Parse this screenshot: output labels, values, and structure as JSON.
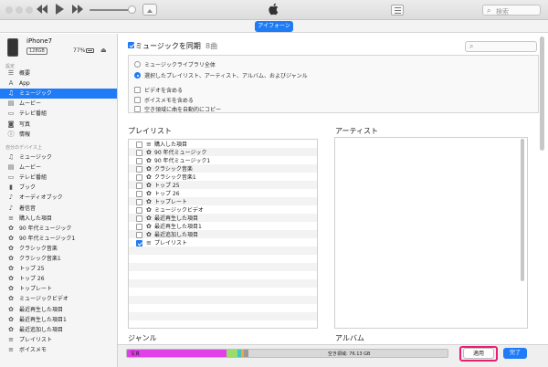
{
  "toolbar": {
    "prev_icon": "rewind-icon",
    "play_icon": "play-icon",
    "next_icon": "fast-forward-icon",
    "search_placeholder": "検索"
  },
  "device_band": {
    "device_tab_label": "アイフォーン"
  },
  "device": {
    "name": "iPhone7",
    "capacity": "128GB",
    "battery": "77%"
  },
  "sidebar": {
    "settings_header": "設定",
    "settings_items": [
      {
        "label": "概要",
        "icon": "summary-icon"
      },
      {
        "label": "App",
        "icon": "app-icon"
      },
      {
        "label": "ミュージック",
        "icon": "music-note-icon",
        "selected": true
      },
      {
        "label": "ムービー",
        "icon": "film-icon"
      },
      {
        "label": "テレビ番組",
        "icon": "tv-icon"
      },
      {
        "label": "写真",
        "icon": "camera-icon"
      },
      {
        "label": "情報",
        "icon": "info-icon"
      }
    ],
    "ondevice_header": "自分のデバイス上",
    "ondevice_items": [
      {
        "label": "ミュージック",
        "icon": "music-note-icon"
      },
      {
        "label": "ムービー",
        "icon": "film-icon"
      },
      {
        "label": "テレビ番組",
        "icon": "tv-icon"
      },
      {
        "label": "ブック",
        "icon": "book-icon"
      },
      {
        "label": "オーディオブック",
        "icon": "audiobook-icon"
      },
      {
        "label": "着信音",
        "icon": "bell-icon"
      },
      {
        "label": "購入した項目",
        "icon": "playlist-icon"
      },
      {
        "label": "90 年代ミュージック",
        "icon": "smart-playlist-icon"
      },
      {
        "label": "90 年代ミュージック1",
        "icon": "smart-playlist-icon"
      },
      {
        "label": "クラシック音楽",
        "icon": "smart-playlist-icon"
      },
      {
        "label": "クラシック音楽1",
        "icon": "smart-playlist-icon"
      },
      {
        "label": "トップ 25",
        "icon": "smart-playlist-icon"
      },
      {
        "label": "トップ 26",
        "icon": "smart-playlist-icon"
      },
      {
        "label": "トップレート",
        "icon": "smart-playlist-icon"
      },
      {
        "label": "ミュージックビデオ",
        "icon": "smart-playlist-icon"
      },
      {
        "label": "最近再生した項目",
        "icon": "smart-playlist-icon"
      },
      {
        "label": "最近再生した項目1",
        "icon": "smart-playlist-icon"
      },
      {
        "label": "最近追加した項目",
        "icon": "smart-playlist-icon"
      },
      {
        "label": "プレイリスト",
        "icon": "playlist-icon"
      },
      {
        "label": "ボイスメモ",
        "icon": "playlist-icon"
      }
    ]
  },
  "main": {
    "sync_label": "ミュージックを同期",
    "sync_count": "8曲",
    "sync_checked": true,
    "search_icon": "search-icon",
    "options": [
      {
        "type": "radio",
        "label": "ミュージックライブラリ全体",
        "checked": false
      },
      {
        "type": "radio",
        "label": "選択したプレイリスト、アーティスト、アルバム、およびジャンル",
        "checked": true
      },
      {
        "type": "checkbox",
        "label": "ビデオを含める",
        "checked": false
      },
      {
        "type": "checkbox",
        "label": "ボイスメモを含める",
        "checked": false
      },
      {
        "type": "checkbox",
        "label": "空き領域に曲を自動的にコピー",
        "checked": false
      }
    ],
    "playlists_title": "プレイリスト",
    "artists_title": "アーティスト",
    "genres_title": "ジャンル",
    "albums_title": "アルバム",
    "playlists": [
      {
        "label": "購入した項目",
        "icon": "playlist-icon",
        "checked": false
      },
      {
        "label": "90 年代ミュージック",
        "icon": "smart-playlist-icon",
        "checked": false
      },
      {
        "label": "90 年代ミュージック1",
        "icon": "smart-playlist-icon",
        "checked": false
      },
      {
        "label": "クラシック音楽",
        "icon": "smart-playlist-icon",
        "checked": false
      },
      {
        "label": "クラシック音楽1",
        "icon": "smart-playlist-icon",
        "checked": false
      },
      {
        "label": "トップ 25",
        "icon": "smart-playlist-icon",
        "checked": false
      },
      {
        "label": "トップ 26",
        "icon": "smart-playlist-icon",
        "checked": false
      },
      {
        "label": "トップレート",
        "icon": "smart-playlist-icon",
        "checked": false
      },
      {
        "label": "ミュージックビデオ",
        "icon": "smart-playlist-icon",
        "checked": false
      },
      {
        "label": "最近再生した項目",
        "icon": "smart-playlist-icon",
        "checked": false
      },
      {
        "label": "最近再生した項目1",
        "icon": "smart-playlist-icon",
        "checked": false
      },
      {
        "label": "最近追加した項目",
        "icon": "smart-playlist-icon",
        "checked": false
      },
      {
        "label": "プレイリスト",
        "icon": "playlist-icon",
        "checked": true
      }
    ]
  },
  "footer": {
    "storage_photos_label": "写真",
    "free_space_label": "空き領域: 76.13 GB",
    "apply_label": "適用",
    "done_label": "完了",
    "storage_segments": [
      {
        "name": "photos",
        "fraction": 0.31,
        "color": "#e040e8"
      },
      {
        "name": "apps",
        "fraction": 0.035,
        "color": "#9bdd6a"
      },
      {
        "name": "other-1",
        "fraction": 0.01,
        "color": "#3fc6c8"
      },
      {
        "name": "other-2",
        "fraction": 0.01,
        "color": "#f3a73b"
      },
      {
        "name": "other-3",
        "fraction": 0.015,
        "color": "#9a9a9a"
      }
    ]
  },
  "colors": {
    "accent": "#1f7bf6",
    "highlight": "#e61f73",
    "band": "#f3f3f3"
  }
}
